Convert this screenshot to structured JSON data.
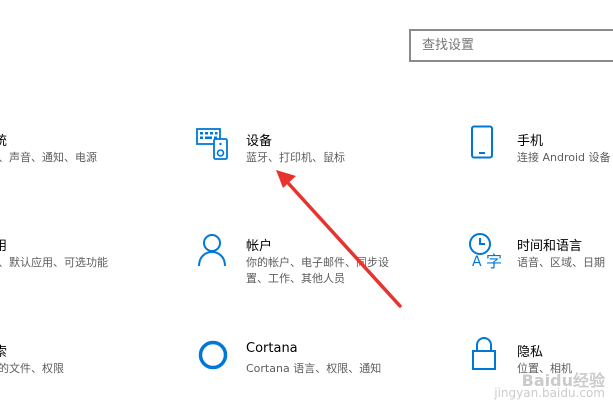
{
  "search": {
    "placeholder": "查找设置"
  },
  "row1": {
    "left": {
      "title": "统",
      "desc": "、声音、通知、电源"
    },
    "center": {
      "title": "设备",
      "desc": "蓝牙、打印机、鼠标"
    },
    "right": {
      "title": "手机",
      "desc": "连接 Android 设备"
    }
  },
  "row2": {
    "left": {
      "title": "用",
      "desc": "、默认应用、可选功能"
    },
    "center": {
      "title": "帐户",
      "desc_line1": "你的帐户、电子邮件、同步设",
      "desc_line2": "置、工作、其他人员"
    },
    "right": {
      "title": "时间和语言",
      "desc": "语音、区域、日期"
    }
  },
  "row3": {
    "left": {
      "title": "索",
      "desc": "的文件、权限"
    },
    "center": {
      "title": "Cortana",
      "desc": "Cortana 语言、权限、通知"
    },
    "right": {
      "title": "隐私",
      "desc": "位置、相机"
    }
  },
  "colors": {
    "accent": "#0078d7",
    "arrow": "#e8322d"
  },
  "watermark": {
    "line1": "Baidu经验",
    "line2": "jingyan.baidu.com"
  }
}
